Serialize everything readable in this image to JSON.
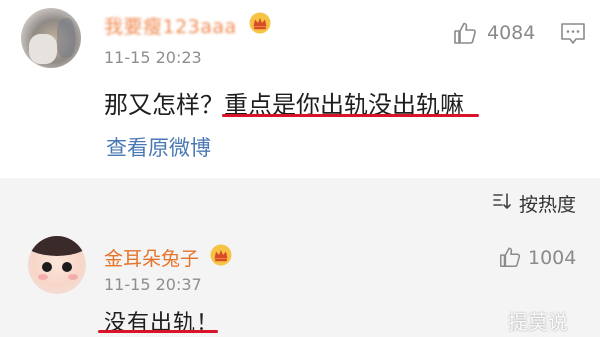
{
  "comments": [
    {
      "username": "我要瘦123aaa",
      "timestamp": "11-15 20:23",
      "like_count": "4084",
      "text_plain": "那又怎样？",
      "text_highlight": "重点是你出轨没出轨嘛",
      "view_original_label": "查看原微博"
    },
    {
      "username": "金耳朵兔子",
      "timestamp": "11-15 20:37",
      "like_count": "1004",
      "text": "没有出轨！"
    }
  ],
  "sort": {
    "label": "按热度"
  },
  "watermark": {
    "text": "提莫说"
  },
  "colors": {
    "username_first": "#f08a52",
    "username_second": "#e5742b",
    "link": "#4a78b4",
    "underline": "#d9132a",
    "secondary_text": "#8e8e8e",
    "sort_background": "#f4f4f4"
  },
  "icons": {
    "like": "thumbs-up-icon",
    "more": "comment-menu-icon",
    "sort": "sort-icon",
    "vip": "crown-icon"
  }
}
